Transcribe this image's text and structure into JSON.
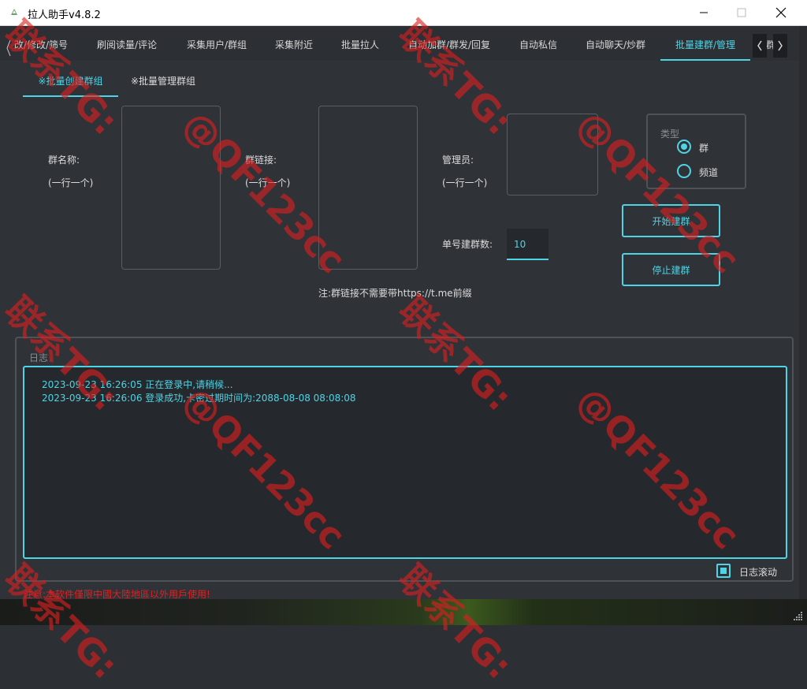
{
  "window": {
    "title": "拉人助手v4.8.2",
    "controls": {
      "minimize_icon": "minimize-icon",
      "maximize_icon": "maximize-icon",
      "close_icon": "close-icon"
    }
  },
  "tabs": [
    {
      "label": "改/修改/筛号"
    },
    {
      "label": "刷阅读量/评论"
    },
    {
      "label": "采集用户/群组"
    },
    {
      "label": "采集附近"
    },
    {
      "label": "批量拉人"
    },
    {
      "label": "自动加群/群发/回复"
    },
    {
      "label": "自动私信"
    },
    {
      "label": "自动聊天/炒群"
    },
    {
      "label": "批量建群/管理",
      "active": true
    },
    {
      "label": "群"
    }
  ],
  "subtabs": [
    {
      "label": "※批量创建群组",
      "active": true
    },
    {
      "label": "※批量管理群组"
    }
  ],
  "form": {
    "group_name_label": "群名称:",
    "group_name_hint": "(一行一个)",
    "group_link_label": "群链接:",
    "group_link_hint": "(一行一个)",
    "admin_label": "管理员:",
    "admin_hint": "(一行一个)",
    "count_label": "单号建群数:",
    "count_value": "10",
    "note": "注:群链接不需要带https://t.me前缀"
  },
  "type_group": {
    "title": "类型",
    "options": [
      {
        "label": "群",
        "checked": true
      },
      {
        "label": "频道",
        "checked": false
      }
    ]
  },
  "buttons": {
    "start": "开始建群",
    "stop": "停止建群"
  },
  "log": {
    "title": "日志",
    "lines": [
      "2023-09-23 16:26:05 正在登录中,请稍候...",
      "2023-09-23 16:26:06 登录成功,卡密过期时间为:2088-08-08 08:08:08"
    ],
    "autoscroll_label": "日志滚动",
    "autoscroll_checked": true
  },
  "footer": {
    "warning": "注意:本软件僅限中國大陸地區以外用戶使用!"
  },
  "watermark": {
    "line1": "联系TG:",
    "line2": "@QF123cc"
  },
  "colors": {
    "accent": "#4fd4e6",
    "background": "#2f3237",
    "warning": "#e02020",
    "watermark": "#dc1e1e"
  }
}
